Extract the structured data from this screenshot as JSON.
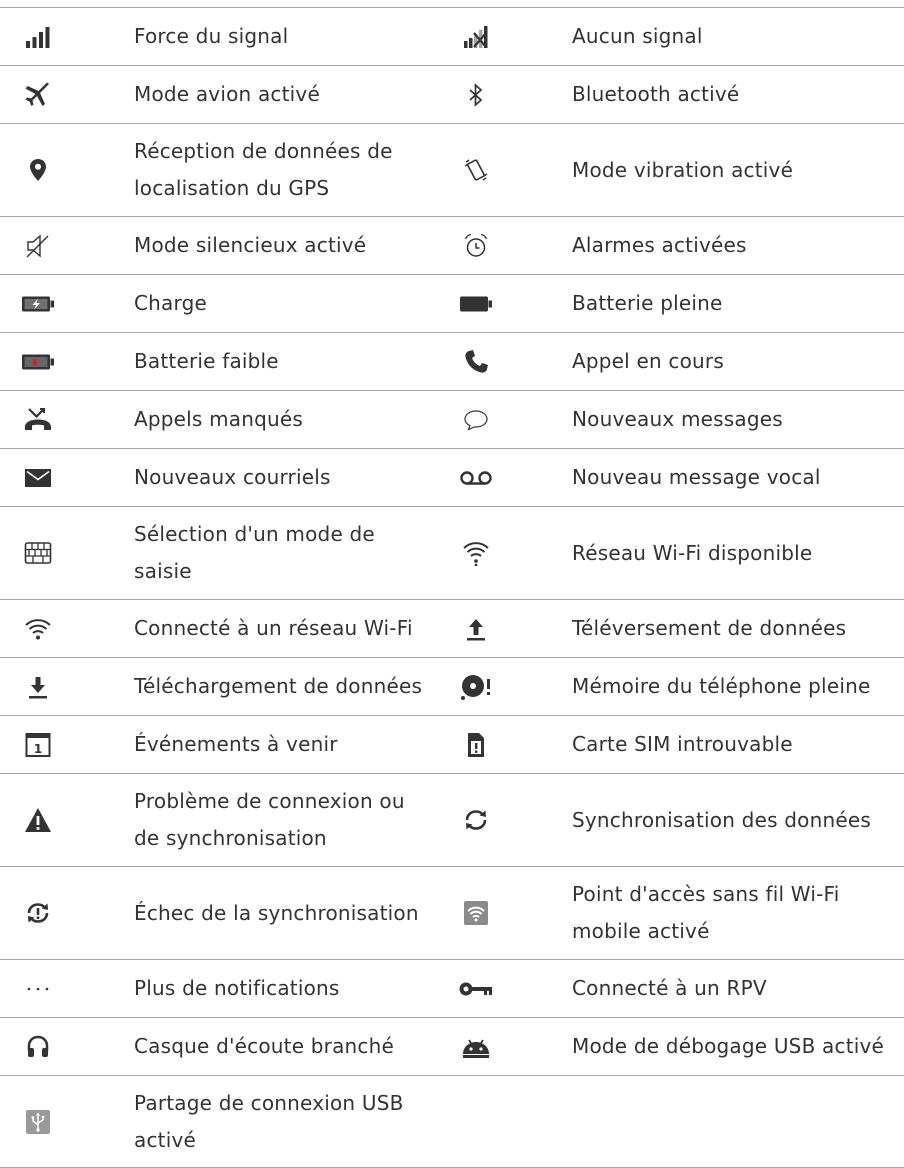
{
  "rows": [
    {
      "left": {
        "icon": "signal-strength-icon",
        "label": "Force du signal"
      },
      "right": {
        "icon": "no-signal-icon",
        "label": "Aucun signal"
      }
    },
    {
      "left": {
        "icon": "airplane-icon",
        "label": "Mode avion activé"
      },
      "right": {
        "icon": "bluetooth-icon",
        "label": "Bluetooth activé"
      }
    },
    {
      "left": {
        "icon": "location-pin-icon",
        "label": "Réception de données de localisation du GPS"
      },
      "right": {
        "icon": "vibrate-icon",
        "label": "Mode vibration activé"
      }
    },
    {
      "left": {
        "icon": "silent-icon",
        "label": "Mode silencieux activé"
      },
      "right": {
        "icon": "alarm-icon",
        "label": "Alarmes activées"
      }
    },
    {
      "left": {
        "icon": "battery-charging-icon",
        "label": "Charge"
      },
      "right": {
        "icon": "battery-full-icon",
        "label": "Batterie pleine"
      }
    },
    {
      "left": {
        "icon": "battery-low-icon",
        "label": "Batterie faible"
      },
      "right": {
        "icon": "phone-call-icon",
        "label": "Appel en cours"
      }
    },
    {
      "left": {
        "icon": "missed-call-icon",
        "label": "Appels manqués"
      },
      "right": {
        "icon": "message-bubble-icon",
        "label": "Nouveaux messages"
      }
    },
    {
      "left": {
        "icon": "envelope-icon",
        "label": "Nouveaux courriels"
      },
      "right": {
        "icon": "voicemail-icon",
        "label": "Nouveau message vocal"
      }
    },
    {
      "left": {
        "icon": "keyboard-icon",
        "label": "Sélection d'un mode de saisie"
      },
      "right": {
        "icon": "wifi-available-icon",
        "label": "Réseau Wi-Fi disponible"
      }
    },
    {
      "left": {
        "icon": "wifi-connected-icon",
        "label": "Connecté à un réseau Wi-Fi"
      },
      "right": {
        "icon": "upload-icon",
        "label": "Téléversement de données"
      }
    },
    {
      "left": {
        "icon": "download-icon",
        "label": "Téléchargement de données"
      },
      "right": {
        "icon": "storage-full-icon",
        "label": "Mémoire du téléphone pleine"
      }
    },
    {
      "left": {
        "icon": "calendar-icon",
        "label": "Événements à venir"
      },
      "right": {
        "icon": "sim-missing-icon",
        "label": "Carte SIM introuvable"
      }
    },
    {
      "left": {
        "icon": "warning-icon",
        "label": "Problème de connexion ou de synchronisation"
      },
      "right": {
        "icon": "sync-icon",
        "label": "Synchronisation des données"
      }
    },
    {
      "left": {
        "icon": "sync-failed-icon",
        "label": "Échec de la synchronisation"
      },
      "right": {
        "icon": "wifi-hotspot-icon",
        "label": "Point d'accès sans fil Wi-Fi mobile activé"
      }
    },
    {
      "left": {
        "icon": "more-icon",
        "label": "Plus de notifications"
      },
      "right": {
        "icon": "vpn-key-icon",
        "label": "Connecté à un RPV"
      }
    },
    {
      "left": {
        "icon": "headset-icon",
        "label": "Casque d'écoute branché"
      },
      "right": {
        "icon": "android-debug-icon",
        "label": "Mode de débogage USB activé"
      }
    },
    {
      "left": {
        "icon": "usb-tether-icon",
        "label": "Partage de connexion USB activé"
      },
      "right": null
    }
  ]
}
